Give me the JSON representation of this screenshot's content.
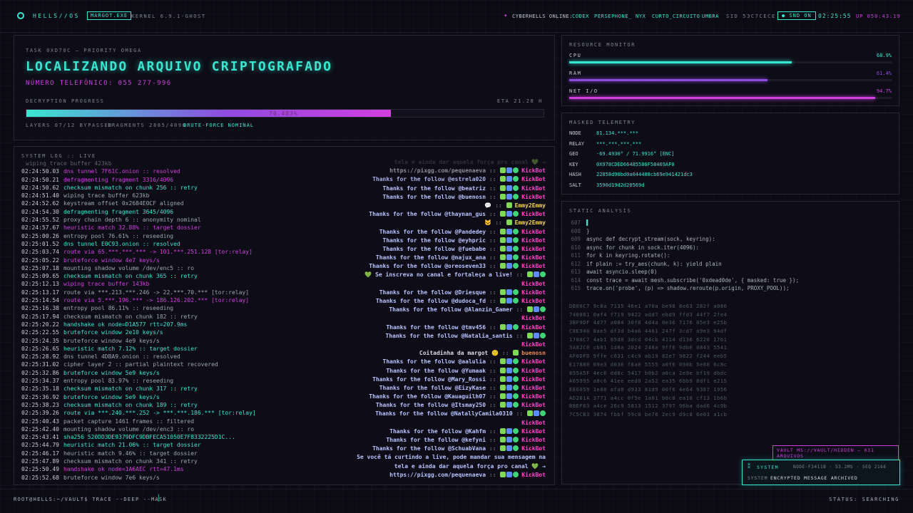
{
  "top": {
    "brand": "HELLS//OS",
    "proc": "MARGOT.EXE",
    "kernel": "KERNEL 6.9.1-GHOST",
    "online_label": "CYBERHELLS ONLINE:",
    "users": [
      "CODEX",
      "PERSEPHONE_",
      "NYX",
      "CURTO_CIRCUITO",
      "UMBRA"
    ],
    "sid": "SID 53C7CECE",
    "snd": "SND ON",
    "clock": "02:25:55",
    "uptime": "UP 050:43:19"
  },
  "task": {
    "label": "TASK 0XD70C — PRIORITY OMEGA",
    "title": "LOCALIZANDO ARQUIVO CRIPTOGRAFADO",
    "phone": "NÚMERO TELEFÔNICO: 055 277-996",
    "progress_label": "DECRYPTION PROGRESS",
    "eta": "ETA 21.28 H",
    "progress_text": "70.483%",
    "progress": 0.705,
    "layers": "LAYERS 07/12 BYPASSED",
    "fragments": "FRAGMENTS 2885/4096",
    "status": "BRUTE-FORCE NOMINAL"
  },
  "resource": {
    "label": "RESOURCE MONITOR",
    "items": [
      {
        "name": "CPU",
        "value": "68.9%",
        "level": 0.689,
        "color": "#39e6d0"
      },
      {
        "name": "RAM",
        "value": "61.4%",
        "level": 0.614,
        "color": "#8f4be0"
      },
      {
        "name": "NET I/O",
        "value": "94.7%",
        "level": 0.947,
        "color": "#d23fe0"
      }
    ]
  },
  "telemetry": {
    "label": "MASKED TELEMETRY",
    "rows": [
      {
        "k": "NODE",
        "v": "81.134.***.***"
      },
      {
        "k": "RELAY",
        "v": "***.***.***.***"
      },
      {
        "k": "GEO",
        "v": "-69.4930° / 71.9916° [ENC]"
      },
      {
        "k": "KEY",
        "v": "0X978CDED66485586F58469AF0"
      },
      {
        "k": "HASH",
        "v": "22858d90bd0a044488cb69e941421dc3"
      },
      {
        "k": "SALT",
        "v": "3590d19d2d20569d"
      }
    ]
  },
  "syslog": {
    "label": "SYSTEM LOG :: LIVE",
    "rows": [
      {
        "t": "",
        "m": "wiping trace buffer 423kb",
        "c": "#9aa7b3"
      },
      {
        "t": "02:24:50.03",
        "m": "dns tunnel 7F61C.onion :: resolved",
        "c": "#d23fe0"
      },
      {
        "t": "02:24:50.21",
        "m": "defragmenting fragment 3316/4096",
        "c": "#d23fe0"
      },
      {
        "t": "02:24:50.62",
        "m": "checksum mismatch on chunk 256 :: retry",
        "c": "#39e6d0"
      },
      {
        "t": "02:24:51.40",
        "m": "wiping trace buffer 623kb",
        "c": "#9aa7b3"
      },
      {
        "t": "02:24:52.62",
        "m": "keystream offset 0x2684E0CF aligned",
        "c": "#9aa7b3"
      },
      {
        "t": "02:24:54.30",
        "m": "defragmenting fragment 3645/4096",
        "c": "#39e6d0"
      },
      {
        "t": "02:24:55.52",
        "m": "proxy chain depth 6 :: anonymity nominal",
        "c": "#9aa7b3"
      },
      {
        "t": "02:24:57.67",
        "m": "heuristic match 32.88% :: target dossier",
        "c": "#d23fe0"
      },
      {
        "t": "02:25:00.26",
        "m": "entropy pool 76.61% :: reseeding",
        "c": "#9aa7b3"
      },
      {
        "t": "02:25:01.52",
        "m": "dns tunnel E0C93.onion :: resolved",
        "c": "#39e6d0"
      },
      {
        "t": "02:25:03.74",
        "m": "route via 65.***.***.*** -> 101.***.251.128 [tor:relay]",
        "c": "#d23fe0"
      },
      {
        "t": "02:25:05.22",
        "m": "bruteforce window 4e7 keys/s",
        "c": "#d23fe0"
      },
      {
        "t": "02:25:07.18",
        "m": "mounting shadow volume /dev/enc5 :: ro",
        "c": "#9aa7b3"
      },
      {
        "t": "02:25:09.65",
        "m": "checksum mismatch on chunk 365 :: retry",
        "c": "#39e6d0"
      },
      {
        "t": "02:25:12.13",
        "m": "wiping trace buffer 143kb",
        "c": "#d23fe0"
      },
      {
        "t": "02:25:13.17",
        "m": "route via ***.213.***.246 -> 22.***.70.*** [tor:relay]",
        "c": "#9aa7b3"
      },
      {
        "t": "02:25:14.54",
        "m": "route via 5.***.196.*** -> 186.126.202.*** [tor:relay]",
        "c": "#d23fe0"
      },
      {
        "t": "02:25:16.38",
        "m": "entropy pool 86.11% :: reseeding",
        "c": "#9aa7b3"
      },
      {
        "t": "02:25:17.94",
        "m": "checksum mismatch on chunk 182 :: retry",
        "c": "#9aa7b3"
      },
      {
        "t": "02:25:20.22",
        "m": "handshake ok node=D1A577 rtt=207.9ms",
        "c": "#39e6d0"
      },
      {
        "t": "02:25:22.55",
        "m": "bruteforce window 2e10 keys/s",
        "c": "#39e6d0"
      },
      {
        "t": "02:25:24.35",
        "m": "bruteforce window 4e9 keys/s",
        "c": "#9aa7b3"
      },
      {
        "t": "02:25:26.65",
        "m": "heuristic match 7.12% :: target dossier",
        "c": "#39e6d0"
      },
      {
        "t": "02:25:28.92",
        "m": "dns tunnel 4DBA9.onion :: resolved",
        "c": "#9aa7b3"
      },
      {
        "t": "02:25:31.02",
        "m": "cipher layer 2 :: partial plaintext recovered",
        "c": "#9aa7b3"
      },
      {
        "t": "02:25:32.86",
        "m": "bruteforce window 5e9 keys/s",
        "c": "#39e6d0"
      },
      {
        "t": "02:25:34.37",
        "m": "entropy pool 83.97% :: reseeding",
        "c": "#9aa7b3"
      },
      {
        "t": "02:25:35.18",
        "m": "checksum mismatch on chunk 317 :: retry",
        "c": "#39e6d0"
      },
      {
        "t": "02:25:36.92",
        "m": "bruteforce window 5e9 keys/s",
        "c": "#39e6d0"
      },
      {
        "t": "02:25:38.23",
        "m": "checksum mismatch on chunk 189 :: retry",
        "c": "#39e6d0"
      },
      {
        "t": "02:25:39.26",
        "m": "route via ***.240.***.252 -> ***.***.186.*** [tor:relay]",
        "c": "#39e6d0"
      },
      {
        "t": "02:25:40.43",
        "m": "packet capture 1461 frames :: filtered",
        "c": "#9aa7b3"
      },
      {
        "t": "02:25:42.40",
        "m": "mounting shadow volume /dev/enc3 :: ro",
        "c": "#9aa7b3"
      },
      {
        "t": "02:25:43.41",
        "m": "sha256 520DD3DE9379DFC9DBFECA51050E7F8332225D1C...",
        "c": "#39e6d0"
      },
      {
        "t": "02:25:44.79",
        "m": "heuristic match 21.06% :: target dossier",
        "c": "#39e6d0"
      },
      {
        "t": "02:25:46.17",
        "m": "heuristic match 9.46% :: target dossier",
        "c": "#9aa7b3"
      },
      {
        "t": "02:25:47.89",
        "m": "checksum mismatch on chunk 341 :: retry",
        "c": "#9aa7b3"
      },
      {
        "t": "02:25:50.49",
        "m": "handshake ok node=1A6AEC rtt=47.1ms",
        "c": "#d23fe0"
      },
      {
        "t": "02:25:52.68",
        "m": "bruteforce window 7e6 keys/s",
        "c": "#9aa7b3"
      }
    ]
  },
  "chat": {
    "rows": [
      {
        "m": "tela e ainda dar aquela força pro canal 💚 →",
        "u": "",
        "c": "#555b66",
        "b": 0
      },
      {
        "m": "https://pixgg.com/pequenaeva",
        "u": "KickBot",
        "c": "#8a8f99",
        "b": 1
      },
      {
        "m": "Thanks for the follow @estrela020",
        "u": "KickBot",
        "c": "#a9aee8",
        "b": 1
      },
      {
        "m": "Thanks for the follow @beatriz",
        "u": "KickBot",
        "c": "#b8c4ff",
        "b": 1
      },
      {
        "m": "Thanks for the follow @buenosn",
        "u": "KickBot",
        "c": "#b8c4ff",
        "b": 1
      },
      {
        "m": "💬",
        "u": "Emmy2Emmy",
        "c": "#d9dde3",
        "b": 2
      },
      {
        "m": "Thanks for the follow @thaynan_gus",
        "u": "KickBot",
        "c": "#b8c4ff",
        "b": 1
      },
      {
        "m": "🐱",
        "u": "Emmy2Emmy",
        "c": "#d9dde3",
        "b": 2
      },
      {
        "m": "Thanks for the follow @Pandedey",
        "u": "KickBot",
        "c": "#b8c4ff",
        "b": 1
      },
      {
        "m": "Thanks for the follow @eyhpric",
        "u": "KickBot",
        "c": "#b8c4ff",
        "b": 1
      },
      {
        "m": "Thanks for the follow @fuebabe",
        "u": "KickBot",
        "c": "#b8c4ff",
        "b": 1
      },
      {
        "m": "Thanks for the follow @najux_ana",
        "u": "KickBot",
        "c": "#b8c4ff",
        "b": 1
      },
      {
        "m": "Thanks for the follow @oreoseven33",
        "u": "KickBot",
        "c": "#b8c4ff",
        "b": 1
      },
      {
        "m": "💚 Se inscreva no canal e fortaleça a live!",
        "u": "",
        "c": "#b8c4ff",
        "b": 1
      },
      {
        "m": "",
        "u": "KickBot",
        "c": "#b8c4ff",
        "b": 0
      },
      {
        "m": "Thanks for the follow @Driesque",
        "u": "KickBot",
        "c": "#b8c4ff",
        "b": 1
      },
      {
        "m": "Thanks for the follow @dudoca_fd",
        "u": "KickBot",
        "c": "#b8c4ff",
        "b": 1
      },
      {
        "m": "Thanks for the follow @Alanzin_Gamer",
        "u": "",
        "c": "#b8c4ff",
        "b": 1
      },
      {
        "m": "",
        "u": "KickBot",
        "c": "#b8c4ff",
        "b": 0
      },
      {
        "m": "Thanks for the follow @tmv456",
        "u": "KickBot",
        "c": "#b8c4ff",
        "b": 1
      },
      {
        "m": "Thanks for the follow @Natalia_santis",
        "u": "",
        "c": "#b8c4ff",
        "b": 1
      },
      {
        "m": "",
        "u": "KickBot",
        "c": "#b8c4ff",
        "b": 0
      },
      {
        "m": "Coitadinha da margot 🙂",
        "u": "buenosn",
        "c": "#d9dde3",
        "b": 3
      },
      {
        "m": "Thanks for the follow @aalulia",
        "u": "KickBot",
        "c": "#b8c4ff",
        "b": 1
      },
      {
        "m": "Thanks for the follow @Yumaak",
        "u": "KickBot",
        "c": "#b8c4ff",
        "b": 1
      },
      {
        "m": "Thanks for the follow @Mary_Rossi",
        "u": "KickBot",
        "c": "#b8c4ff",
        "b": 1
      },
      {
        "m": "Thanks for the follow @EizyKase",
        "u": "KickBot",
        "c": "#b8c4ff",
        "b": 1
      },
      {
        "m": "Thanks for the follow @Kauaguilh07",
        "u": "KickBot",
        "c": "#b8c4ff",
        "b": 1
      },
      {
        "m": "Thanks for the follow @Itsmay250",
        "u": "KickBot",
        "c": "#b8c4ff",
        "b": 1
      },
      {
        "m": "Thanks for the follow @NatallyCamila0310",
        "u": "",
        "c": "#b8c4ff",
        "b": 1
      },
      {
        "m": "",
        "u": "KickBot",
        "c": "#b8c4ff",
        "b": 0
      },
      {
        "m": "Thanks for the follow @Kahfm",
        "u": "KickBot",
        "c": "#b8c4ff",
        "b": 1
      },
      {
        "m": "Thanks for the follow @kefyni",
        "u": "KickBot",
        "c": "#b8c4ff",
        "b": 1
      },
      {
        "m": "Thanks for the follow @SchuabVana",
        "u": "KickBot",
        "c": "#b8c4ff",
        "b": 1
      },
      {
        "m": "Se você tá curtindo a live, pode mandar sua mensagem na",
        "u": "",
        "c": "#b8c4ff",
        "b": 0
      },
      {
        "m": "tela e ainda dar aquela força pro canal 💚 →",
        "u": "",
        "c": "#b8c4ff",
        "b": 0
      },
      {
        "m": "https://pixgg.com/pequenaeva",
        "u": "KickBot",
        "c": "#b8c4ff",
        "b": 1
      }
    ]
  },
  "static": {
    "label": "STATIC ANALYSIS",
    "code": [
      {
        "n": "607",
        "t": "▌"
      },
      {
        "n": "608",
        "t": "}"
      },
      {
        "n": "609",
        "t": "async def decrypt_stream(sock, keyring):"
      },
      {
        "n": "610",
        "t": "async for chunk in sock.iter(4096):"
      },
      {
        "n": "611",
        "t": "for k in keyring.rotate():"
      },
      {
        "n": "612",
        "t": "if plain := try_aes(chunk, k): yield plain"
      },
      {
        "n": "613",
        "t": "await asyncio.sleep(0)"
      },
      {
        "n": "614",
        "t": "const trace = await mesh.subscribe('0xdead0de', { masked: true });"
      },
      {
        "n": "615",
        "t": "trace.on('probe', (p) => shadow.reroute(p.origin, PROXY_POOL));"
      }
    ],
    "hex": [
      "DB06C7 9c8a 7135 46e1 a70a be98 8e63 282f a086",
      "740881 0af4 f719 9422 add7 ebd9 ffd3 44f7 2fe4",
      "3BF9DF 4d77 a084 30f8 4d4a 0e36 7176 05e3 e25b",
      "C8E940 8ae5 df3d b4a6 4461 247f 3cd7 a9e3 94df",
      "1788C7 4ab1 85d0 3dcd 04cb 4114 d136 6220 17b1",
      "3A82C0 cb01 1d8a 2024 248a 9ff6 9db0 0843 5541",
      "AF0DFD 9ffe c631 c4c9 ab19 82e7 9822 f244 eeb5",
      "E17880 09e3 d036 f6a0 5555 a0f6 090b 5e68 6c8c",
      "855A5F 4ec6 dd8c 5417 b0b2 a0ca 2e9e bf19 dbdc",
      "A65995 a8c6 41ee eed0 2a52 ea35 6bb9 8df1 e215",
      "EE6059 1e80 afa0 d933 81d9 00f6 4e64 9387 1956",
      "AD201A 3771 a4cc 0f5e 1a01 b0c8 ea18 cf13 1b6b",
      "BBEF63 a4ce 26c9 5813 1512 3797 96ba dad6 4c9b",
      "7C5CB3 3874 fbbf 59c0 be76 2ec9 d9c8 6e03 a1cb"
    ]
  },
  "vault": "VAULT MS://VAULT/HIDDEN — 031 ARQUIVOS",
  "system": {
    "label": "SYSTEM",
    "meta": "NODE-F3411B · 53.2MS · SEQ 2166",
    "msg_pre": "SYSTEM",
    "msg": "ENCRYPTED MESSAGE ARCHIVED"
  },
  "prompt": "ROOT@HELLS:~/VAULT$ TRACE --DEEP --MASK",
  "status": "STATUS: SEARCHING"
}
